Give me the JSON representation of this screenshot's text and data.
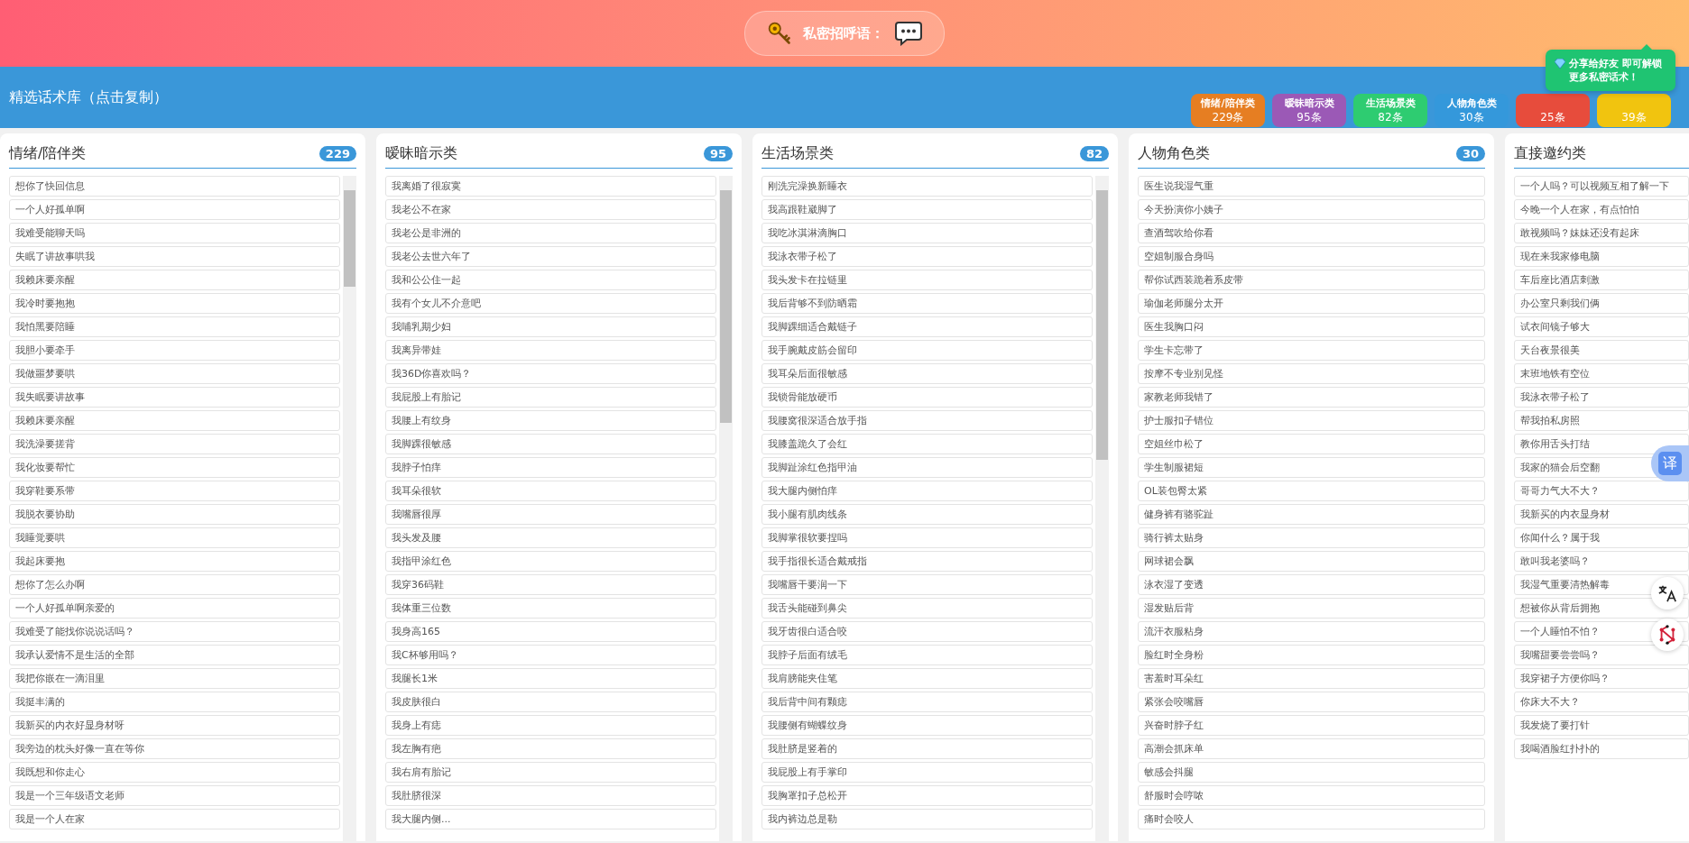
{
  "header": {
    "title": "私密招呼语："
  },
  "library": {
    "title": "精选话术库（点击复制）",
    "tags": [
      {
        "label": "情绪/陪伴类",
        "count": "229条",
        "color": "#e67e22"
      },
      {
        "label": "暧昧暗示类",
        "count": "95条",
        "color": "#9b59b6"
      },
      {
        "label": "生活场景类",
        "count": "82条",
        "color": "#2ecc71"
      },
      {
        "label": "人物角色类",
        "count": "30条",
        "color": "#3498db"
      },
      {
        "count": "25条",
        "color": "#e74c3c"
      },
      {
        "count": "39条",
        "color": "#f1c40f"
      }
    ]
  },
  "tooltip": {
    "text": "分享给好友 即可解锁更多私密话术！"
  },
  "columns": [
    {
      "title": "情绪/陪伴类",
      "count": "229",
      "scrollable": true,
      "items": [
        "想你了快回信息",
        "一个人好孤单啊",
        "我难受能聊天吗",
        "失眠了讲故事哄我",
        "我赖床要亲醒",
        "我冷时要抱抱",
        "我怕黑要陪睡",
        "我胆小要牵手",
        "我做噩梦要哄",
        "我失眠要讲故事",
        "我赖床要亲醒",
        "我洗澡要搓背",
        "我化妆要帮忙",
        "我穿鞋要系带",
        "我脱衣要协助",
        "我睡觉要哄",
        "我起床要抱",
        "想你了怎么办啊",
        "一个人好孤单啊亲爱的",
        "我难受了能找你说说话吗？",
        "我承认爱情不是生活的全部",
        "我把你嵌在一滴泪里",
        "我挺丰满的",
        "我新买的内衣好显身材呀",
        "我旁边的枕头好像一直在等你",
        "我既想和你走心",
        "我是一个三年级语文老师",
        "我是一个人在家"
      ]
    },
    {
      "title": "暧昧暗示类",
      "count": "95",
      "scrollable": true,
      "items": [
        "我离婚了很寂寞",
        "我老公不在家",
        "我老公是非洲的",
        "我老公去世六年了",
        "我和公公住一起",
        "我有个女儿不介意吧",
        "我哺乳期少妇",
        "我离异带娃",
        "我36D你喜欢吗？",
        "我屁股上有胎记",
        "我腰上有纹身",
        "我脚踝很敏感",
        "我脖子怕痒",
        "我耳朵很软",
        "我嘴唇很厚",
        "我头发及腰",
        "我指甲涂红色",
        "我穿36码鞋",
        "我体重三位数",
        "我身高165",
        "我C杯够用吗？",
        "我腿长1米",
        "我皮肤很白",
        "我身上有痣",
        "我左胸有疤",
        "我右肩有胎记",
        "我肚脐很深",
        "我大腿内侧..."
      ]
    },
    {
      "title": "生活场景类",
      "count": "82",
      "scrollable": true,
      "items": [
        "刚洗完澡换新睡衣",
        "我高跟鞋崴脚了",
        "我吃冰淇淋滴胸口",
        "我泳衣带子松了",
        "我头发卡在拉链里",
        "我后背够不到防晒霜",
        "我脚踝细适合戴链子",
        "我手腕戴皮筋会留印",
        "我耳朵后面很敏感",
        "我锁骨能放硬币",
        "我腰窝很深适合放手指",
        "我膝盖跪久了会红",
        "我脚趾涂红色指甲油",
        "我大腿内侧怕痒",
        "我小腿有肌肉线条",
        "我脚掌很软要捏吗",
        "我手指很长适合戴戒指",
        "我嘴唇干要润一下",
        "我舌头能碰到鼻尖",
        "我牙齿很白适合咬",
        "我脖子后面有绒毛",
        "我肩膀能夹住笔",
        "我后背中间有颗痣",
        "我腰侧有蝴蝶纹身",
        "我肚脐是竖着的",
        "我屁股上有手掌印",
        "我胸罩扣子总松开",
        "我内裤边总是勒"
      ]
    },
    {
      "title": "人物角色类",
      "count": "30",
      "scrollable": false,
      "items": [
        "医生说我湿气重",
        "今天扮演你小姨子",
        "查酒驾吹给你看",
        "空姐制服合身吗",
        "帮你试西装跪着系皮带",
        "瑜伽老师腿分太开",
        "医生我胸口闷",
        "学生卡忘带了",
        "按摩不专业别见怪",
        "家教老师我错了",
        "护士服扣子错位",
        "空姐丝巾松了",
        "学生制服裙短",
        "OL装包臀太紧",
        "健身裤有骆驼趾",
        "骑行裤太贴身",
        "网球裙会飘",
        "泳衣湿了变透",
        "湿发贴后背",
        "流汗衣服粘身",
        "脸红时全身粉",
        "害羞时耳朵红",
        "紧张会咬嘴唇",
        "兴奋时脖子红",
        "高潮会抓床单",
        "敏感会抖腿",
        "舒服时会哼哝",
        "痛时会咬人"
      ]
    },
    {
      "title": "直接邀约类",
      "scrollable": false,
      "items": [
        "一个人吗？可以视频互相了解一下",
        "今晚一个人在家，有点怕怕",
        "敢视频吗？妹妹还没有起床",
        "现在来我家修电脑",
        "车后座比酒店刺激",
        "办公室只剩我们俩",
        "试衣间镜子够大",
        "天台夜景很美",
        "末班地铁有空位",
        "我泳衣带子松了",
        "帮我拍私房照",
        "教你用舌头打结",
        "我家的猫会后空翻",
        "哥哥力气大不大？",
        "我新买的内衣显身材",
        "你闻什么？属于我",
        "敢叫我老婆吗？",
        "我湿气重要清热解毒",
        "想被你从背后拥抱",
        "一个人睡怕不怕？",
        "我嘴甜要尝尝吗？",
        "我穿裙子方便你吗？",
        "你床大不大？",
        "我发烧了要打针",
        "我喝酒脸红扑扑的"
      ]
    }
  ],
  "side_tools": {
    "translate_label": "译"
  }
}
